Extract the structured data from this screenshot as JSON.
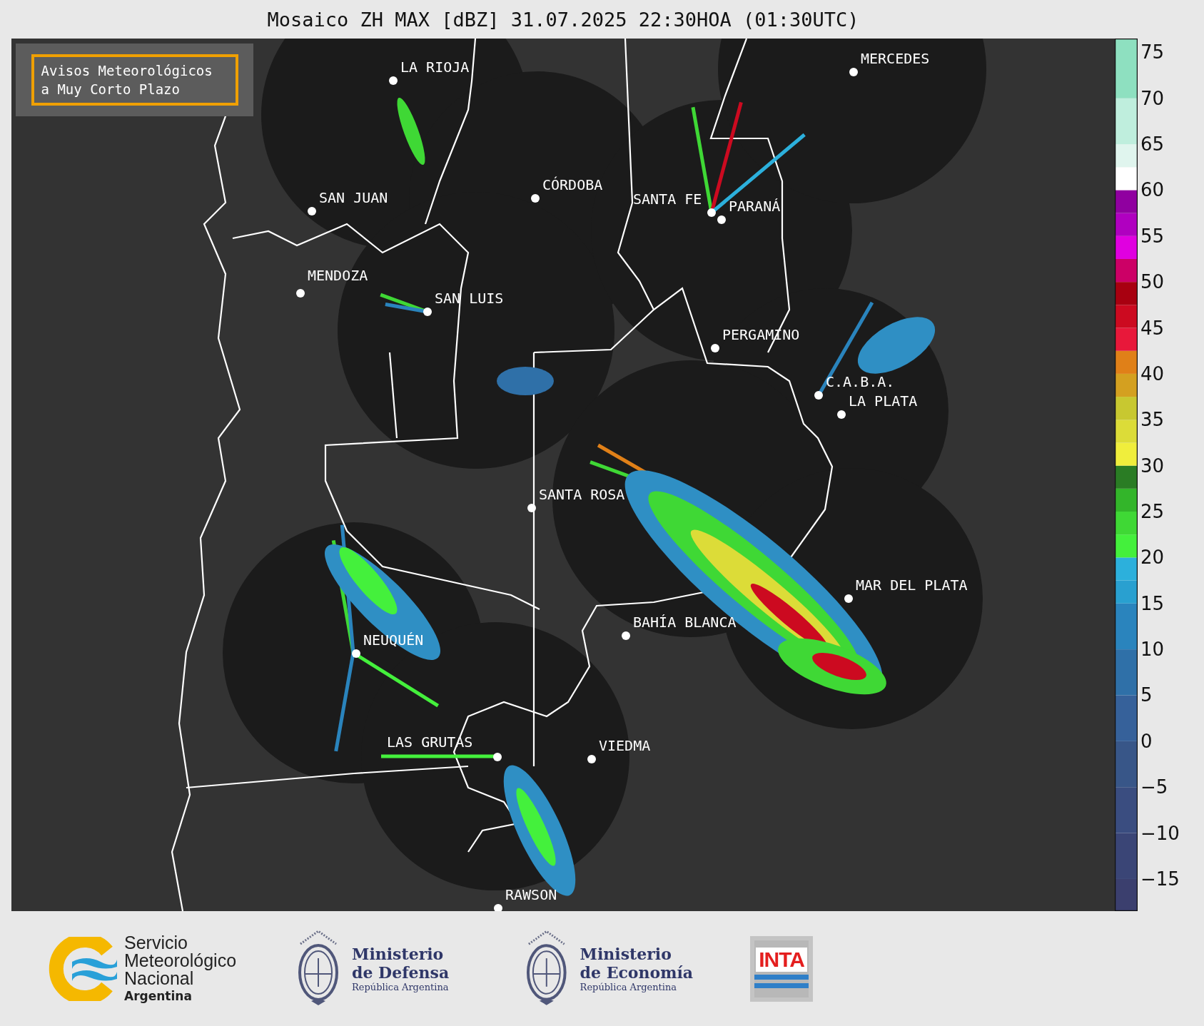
{
  "title": "Mosaico ZH MAX [dBZ] 31.07.2025 22:30HOA (01:30UTC)",
  "notice": "Avisos Meteorológicos a Muy Corto Plazo",
  "cities": [
    {
      "name": "LA RIOJA"
    },
    {
      "name": "MERCEDES"
    },
    {
      "name": "CÓRDOBA"
    },
    {
      "name": "SAN JUAN"
    },
    {
      "name": "SANTA FE"
    },
    {
      "name": "PARANÁ"
    },
    {
      "name": "MENDOZA"
    },
    {
      "name": "SAN LUIS"
    },
    {
      "name": "PERGAMINO"
    },
    {
      "name": "C.A.B.A."
    },
    {
      "name": "LA PLATA"
    },
    {
      "name": "SANTA ROSA"
    },
    {
      "name": "MAR DEL PLATA"
    },
    {
      "name": "BAHÍA BLANCA"
    },
    {
      "name": "NEUQUÉN"
    },
    {
      "name": "LAS GRUTAS"
    },
    {
      "name": "VIEDMA"
    },
    {
      "name": "RAWSON"
    }
  ],
  "colorbar_ticks": [
    "75",
    "70",
    "65",
    "60",
    "55",
    "50",
    "45",
    "40",
    "35",
    "30",
    "25",
    "20",
    "15",
    "10",
    "5",
    "0",
    "−5",
    "−10",
    "−15"
  ],
  "logos": {
    "smn": {
      "lines": [
        "Servicio",
        "Meteorológico",
        "Nacional"
      ],
      "country": "Argentina"
    },
    "ministries": [
      {
        "line1": "Ministerio",
        "line2": "de Defensa",
        "sub": "República Argentina"
      },
      {
        "line1": "Ministerio",
        "line2": "de Economía",
        "sub": "República Argentina"
      }
    ],
    "inta": "INTA"
  }
}
